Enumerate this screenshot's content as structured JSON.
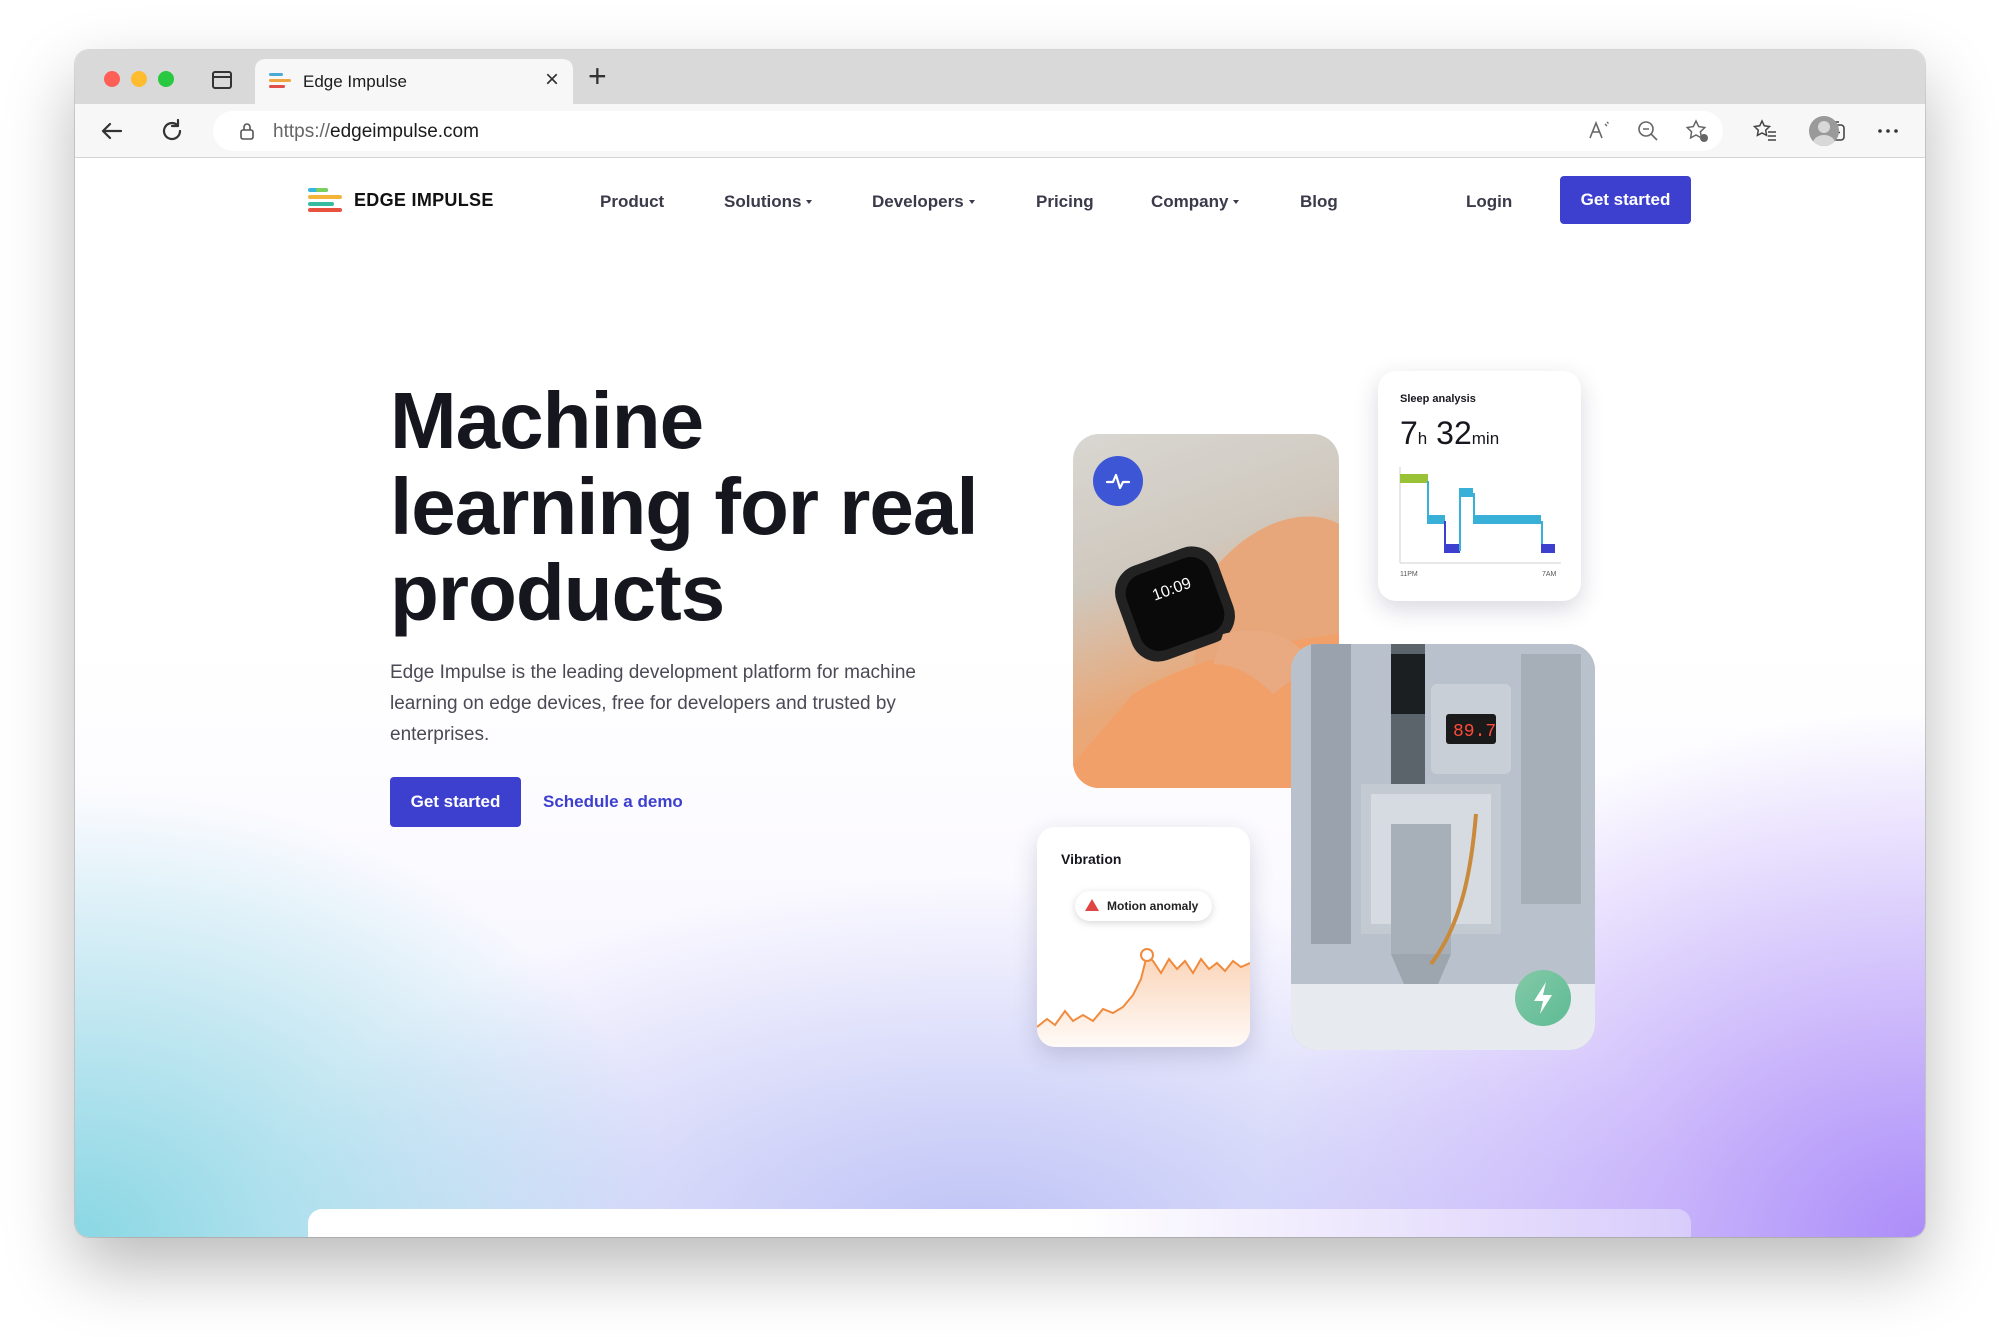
{
  "browser": {
    "tab_title": "Edge Impulse",
    "close_glyph": "×",
    "new_tab_glyph": "+",
    "url_protocol": "https://",
    "url_host": "edgeimpulse.com",
    "icons": [
      "back-arrow-icon",
      "reload-icon",
      "lock-icon",
      "read-aloud-icon",
      "zoom-out-icon",
      "add-favorite-icon",
      "favorites-icon",
      "collections-icon",
      "profile-avatar",
      "more-icon"
    ]
  },
  "site": {
    "logo_text": "EDGE IMPULSE",
    "nav": {
      "product": "Product",
      "solutions": "Solutions",
      "developers": "Developers",
      "pricing": "Pricing",
      "company": "Company",
      "blog": "Blog",
      "login": "Login",
      "cta": "Get started"
    },
    "brand_color": "#3d3fcf"
  },
  "hero": {
    "title": "Machine learning for real products",
    "subtitle": "Edge Impulse is the leading development platform for machine learning on edge devices, free for developers and trusted by enterprises.",
    "primary_cta": "Get started",
    "secondary_cta": "Schedule a demo"
  },
  "cards": {
    "sleep": {
      "title": "Sleep analysis",
      "hours": "7",
      "hours_unit": "h",
      "minutes": "32",
      "minutes_unit": "min",
      "axis_start": "11PM",
      "axis_end": "7AM"
    },
    "vibration": {
      "title": "Vibration",
      "alert": "Motion anomaly"
    },
    "machine": {
      "display": "89.7"
    }
  }
}
